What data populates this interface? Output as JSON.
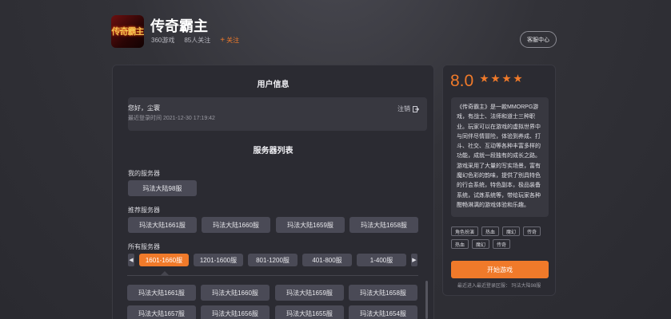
{
  "header": {
    "logo_text": "传奇霸主",
    "title": "传奇霸主",
    "source": "360游戏",
    "followers": "85人关注",
    "follow_label": "关注",
    "review_label": "客服中心"
  },
  "user": {
    "section_title": "用户信息",
    "greeting": "您好，尘寰",
    "last_login": "最近登录时间 2021-12-30 17:19:42",
    "logout_label": "注销"
  },
  "servers": {
    "section_title": "服务器列表",
    "my_label": "我的服务器",
    "my": [
      "玛法大陆98服"
    ],
    "recommended_label": "推荐服务器",
    "recommended": [
      "玛法大陆1661服",
      "玛法大陆1660服",
      "玛法大陆1659服",
      "玛法大陆1658服"
    ],
    "all_label": "所有服务器",
    "ranges": [
      "1601-1660服",
      "1201-1600服",
      "801-1200服",
      "401-800服",
      "1-400服"
    ],
    "active_range": "1601-1660服",
    "list": [
      "玛法大陆1661服",
      "玛法大陆1660服",
      "玛法大陆1659服",
      "玛法大陆1658服",
      "玛法大陆1657服",
      "玛法大陆1656服",
      "玛法大陆1655服",
      "玛法大陆1654服"
    ]
  },
  "side": {
    "score": "8.0",
    "stars": 4,
    "description": "《传奇霸主》是一款MMORPG游戏，有战士、法师和道士三种职业。玩家可以在游戏的虚拟世界中与同伴尽情冒险，体验到养成、打斗、社交、互动等各种丰富多样的功能，成就一段独有的成长之路。游戏采用了大量的写实场景，富有魔幻色彩的韵味，提供了别具特色的行会系统，特色副本，极品装备系统，试炼系统等，带给玩家各种酣畅淋漓的游戏体验和乐趣。",
    "tags": [
      "角色扮演",
      "热血",
      "魔幻",
      "传奇",
      "热血",
      "魔幻",
      "传奇"
    ],
    "play_label": "开始游戏",
    "recent_text": "最近进入最近登录区服：  玛法大陆98服"
  },
  "colors": {
    "accent": "#f07a2a",
    "panel": "#2b2b32",
    "button": "#4a4a56"
  },
  "icons": {
    "logout": "logout-icon",
    "follow": "plus-icon",
    "prev": "chevron-left-icon",
    "next": "chevron-right-icon"
  }
}
